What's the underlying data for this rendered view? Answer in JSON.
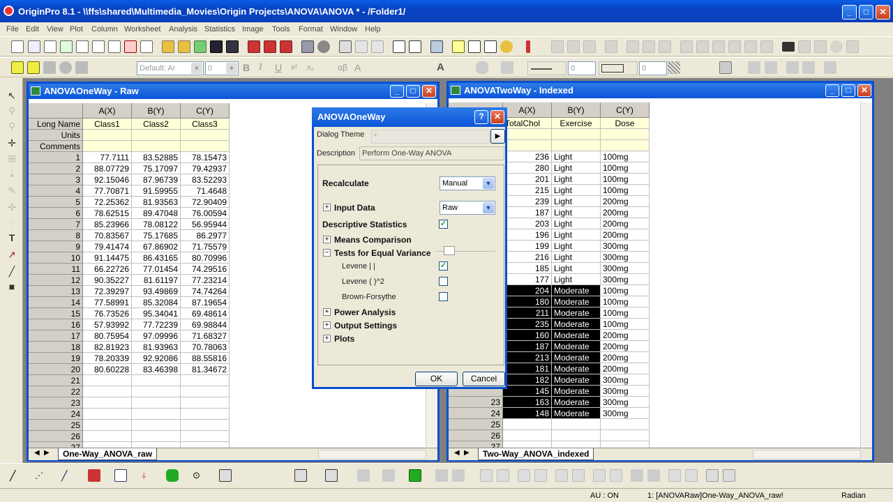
{
  "app": {
    "title": "OriginPro 8.1 - \\\\ffs\\shared\\Multimedia_Movies\\Origin Projects\\ANOVA\\ANOVA * - /Folder1/"
  },
  "menu": [
    "File",
    "Edit",
    "View",
    "Plot",
    "Column",
    "Worksheet",
    "Analysis",
    "Statistics",
    "Image",
    "Tools",
    "Format",
    "Window",
    "Help"
  ],
  "format_toolbar": {
    "font_family": "Default: Ar",
    "font_size": "0",
    "line_width": "0",
    "size2": "0"
  },
  "window_left": {
    "title": "ANOVAOneWay - Raw",
    "columns": [
      "A(X)",
      "B(Y)",
      "C(Y)"
    ],
    "label_rows": [
      "Long Name",
      "Units",
      "Comments"
    ],
    "long_names": [
      "Class1",
      "Class2",
      "Class3"
    ],
    "rows": [
      [
        "77.7111",
        "83.52885",
        "78.15473"
      ],
      [
        "88.07729",
        "75.17097",
        "79.42937"
      ],
      [
        "92.15046",
        "87.96739",
        "83.52293"
      ],
      [
        "77.70871",
        "91.59955",
        "71.4648"
      ],
      [
        "72.25362",
        "81.93563",
        "72.90409"
      ],
      [
        "78.62515",
        "89.47048",
        "76.00594"
      ],
      [
        "85.23966",
        "78.08122",
        "56.95944"
      ],
      [
        "70.83567",
        "75.17685",
        "86.2977"
      ],
      [
        "79.41474",
        "67.86902",
        "71.75579"
      ],
      [
        "91.14475",
        "86.43165",
        "80.70996"
      ],
      [
        "66.22726",
        "77.01454",
        "74.29516"
      ],
      [
        "90.35227",
        "81.61197",
        "77.23214"
      ],
      [
        "72.39297",
        "93.49869",
        "74.74264"
      ],
      [
        "77.58991",
        "85.32084",
        "87.19654"
      ],
      [
        "76.73526",
        "95.34041",
        "69.48614"
      ],
      [
        "57.93992",
        "77.72239",
        "69.98844"
      ],
      [
        "80.75954",
        "97.09996",
        "71.68327"
      ],
      [
        "82.81923",
        "81.93963",
        "70.78063"
      ],
      [
        "78.20339",
        "92.92086",
        "88.55816"
      ],
      [
        "80.60228",
        "83.46398",
        "81.34672"
      ]
    ],
    "row_numbers": [
      "1",
      "2",
      "3",
      "4",
      "5",
      "6",
      "7",
      "8",
      "9",
      "10",
      "11",
      "12",
      "13",
      "14",
      "15",
      "16",
      "17",
      "18",
      "19",
      "20",
      "21",
      "22",
      "23",
      "24",
      "25",
      "26",
      "27"
    ],
    "sheet_tab": "One-Way_ANOVA_raw"
  },
  "window_right": {
    "title": "ANOVATwoWay - Indexed",
    "columns": [
      "A(X)",
      "B(Y)",
      "C(Y)"
    ],
    "long_names": [
      "TotalChol",
      "Exercise",
      "Dose"
    ],
    "rows": [
      [
        "236",
        "Light",
        "100mg"
      ],
      [
        "280",
        "Light",
        "100mg"
      ],
      [
        "201",
        "Light",
        "100mg"
      ],
      [
        "215",
        "Light",
        "100mg"
      ],
      [
        "239",
        "Light",
        "200mg"
      ],
      [
        "187",
        "Light",
        "200mg"
      ],
      [
        "203",
        "Light",
        "200mg"
      ],
      [
        "196",
        "Light",
        "200mg"
      ],
      [
        "199",
        "Light",
        "300mg"
      ],
      [
        "216",
        "Light",
        "300mg"
      ],
      [
        "185",
        "Light",
        "300mg"
      ],
      [
        "177",
        "Light",
        "300mg"
      ],
      [
        "204",
        "Moderate",
        "100mg"
      ],
      [
        "180",
        "Moderate",
        "100mg"
      ],
      [
        "211",
        "Moderate",
        "100mg"
      ],
      [
        "235",
        "Moderate",
        "100mg"
      ],
      [
        "160",
        "Moderate",
        "200mg"
      ],
      [
        "187",
        "Moderate",
        "200mg"
      ],
      [
        "213",
        "Moderate",
        "200mg"
      ],
      [
        "181",
        "Moderate",
        "200mg"
      ],
      [
        "182",
        "Moderate",
        "300mg"
      ],
      [
        "145",
        "Moderate",
        "300mg"
      ],
      [
        "163",
        "Moderate",
        "300mg"
      ],
      [
        "148",
        "Moderate",
        "300mg"
      ]
    ],
    "visible_row_numbers": [
      "23",
      "24",
      "25",
      "26",
      "27"
    ],
    "sheet_tab": "Two-Way_ANOVA_indexed"
  },
  "dialog": {
    "title": "ANOVAOneWay",
    "help": "?",
    "close": "✕",
    "theme_label": "Dialog Theme",
    "theme_value": "*",
    "description_label": "Description",
    "description_value": "Perform One-Way ANOVA",
    "recalculate_label": "Recalculate",
    "recalculate_value": "Manual",
    "input_data_label": "Input Data",
    "input_data_value": "Raw",
    "descriptive_label": "Descriptive Statistics",
    "means_label": "Means Comparison",
    "variance_label": "Tests for Equal Variance",
    "levene_abs": "Levene  |  |",
    "levene_sq": "Levene  (  )^2",
    "brown": "Brown-Forsythe",
    "power_label": "Power Analysis",
    "output_label": "Output Settings",
    "plots_label": "Plots",
    "ok": "OK",
    "cancel": "Cancel"
  },
  "status": {
    "au": "AU : ON",
    "active": "1: [ANOVARaw]One-Way_ANOVA_raw!",
    "angle": "Radian"
  }
}
